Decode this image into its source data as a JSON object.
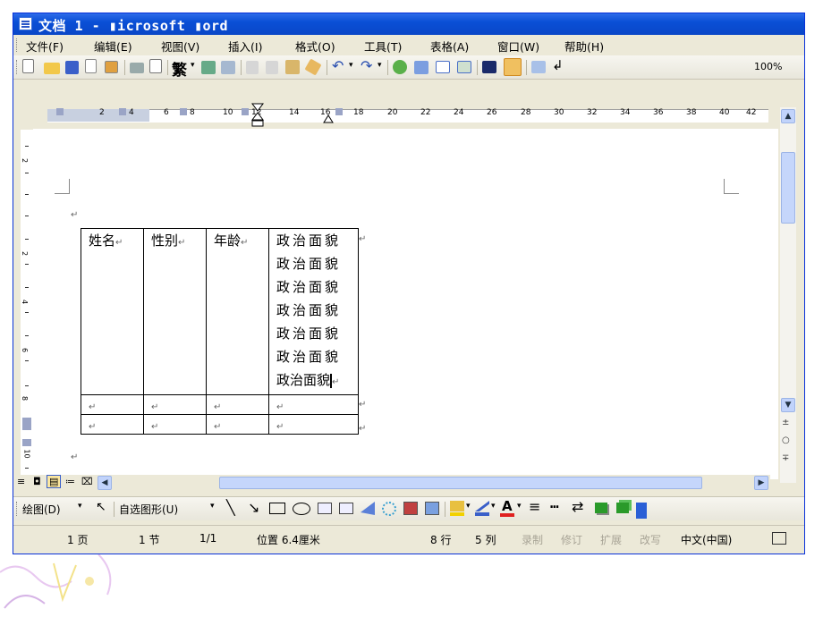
{
  "window": {
    "title": "文档 1 - Microsoft Word",
    "title_display": "文档 1 - ▮icrosoft ▮ord"
  },
  "menu": [
    "文件(F)",
    "编辑(E)",
    "视图(V)",
    "插入(I)",
    "格式(O)",
    "工具(T)",
    "表格(A)",
    "窗口(W)",
    "帮助(H)"
  ],
  "toolbar": {
    "traditional_label": "繁",
    "zoom": "100%"
  },
  "ruler": {
    "numbers": [
      "2",
      "4",
      "6",
      "8",
      "10",
      "12",
      "14",
      "16",
      "18",
      "20",
      "22",
      "24",
      "26",
      "28",
      "30",
      "32",
      "34",
      "36",
      "38",
      "40",
      "42"
    ],
    "vertical_numbers": [
      "2",
      "2",
      "4",
      "6",
      "8",
      "10"
    ]
  },
  "table": {
    "headers": [
      "姓名",
      "性别",
      "年龄"
    ],
    "col4_lines": [
      "政治面貌",
      "政治面貌",
      "政治面貌",
      "政治面貌",
      "政治面貌",
      "政治面貌",
      "政治面貌"
    ],
    "empty_rows": 2,
    "para_mark": "↵"
  },
  "drawbar": {
    "draw_label": "绘图(D)",
    "autoshapes_label": "自选图形(U)"
  },
  "status": {
    "page": "1 页",
    "section": "1 节",
    "pages": "1/1",
    "position": "位置 6.4厘米",
    "line": "8 行",
    "column": "5 列",
    "rec": "录制",
    "trk": "修订",
    "ext": "扩展",
    "ovr": "改写",
    "lang": "中文(中国)"
  },
  "colors": {
    "titlebar": "#0a4fd6",
    "chrome": "#ece9d8",
    "scroll": "#c5d6fb"
  }
}
